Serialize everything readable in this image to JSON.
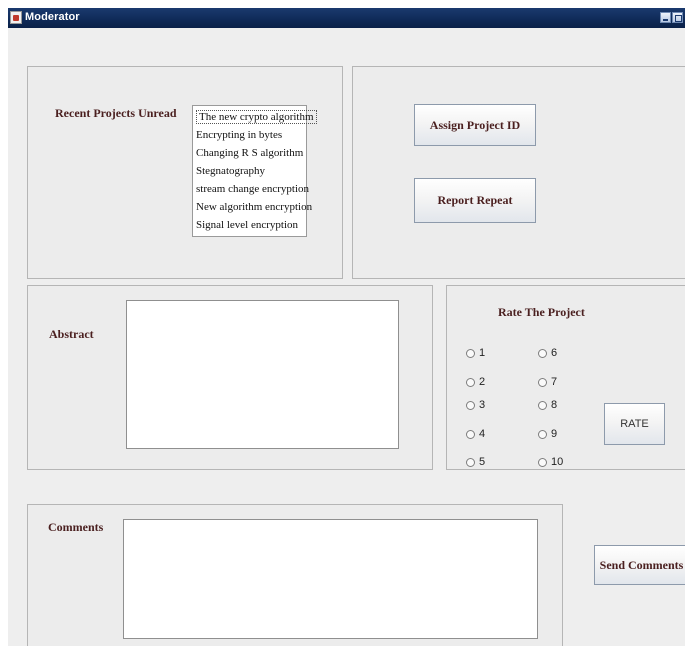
{
  "window": {
    "title": "Moderator"
  },
  "projects": {
    "label": "Recent Projects Unread",
    "items": [
      "The new crypto algorithm",
      "Encrypting in bytes",
      "Changing R S algorithm",
      "Stegnatography",
      "stream change encryption",
      "New algorithm encryption",
      "Signal level encryption"
    ],
    "selected_index": 0
  },
  "actions": {
    "assign_label": "Assign Project ID",
    "report_label": "Report Repeat"
  },
  "abstract": {
    "label": "Abstract",
    "value": ""
  },
  "rating": {
    "title": "Rate The Project",
    "options": [
      "1",
      "2",
      "3",
      "4",
      "5",
      "6",
      "7",
      "8",
      "9",
      "10"
    ],
    "button_label": "RATE"
  },
  "comments": {
    "label": "Comments",
    "value": "",
    "send_label": "Send Comments"
  }
}
